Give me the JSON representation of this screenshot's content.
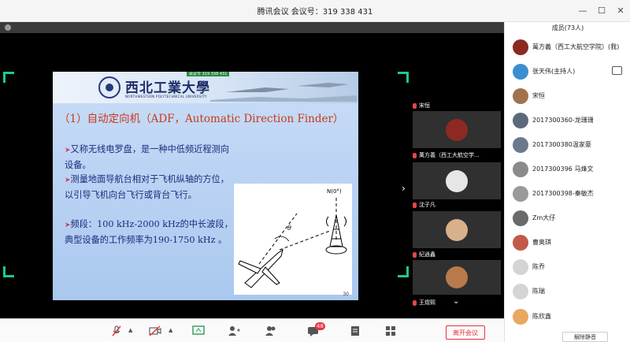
{
  "window": {
    "title": "腾讯会议  会议号：319 338 431",
    "controls": [
      "—",
      "☐",
      "✕"
    ]
  },
  "slide": {
    "university_cn": "西北工業大學",
    "university_en": "NORTHWESTERN POLYTECHNICAL UNIVERSITY",
    "meeting_tag": "会议号 319 338 431",
    "title": "（1）自动定向机（ADF，Automatic Direction Finder）",
    "bullets": [
      {
        "arrow": "➤",
        "text": "又称无线电罗盘，是一种中低频近程测向设备。"
      },
      {
        "arrow": "➤",
        "text": "测量地面导航台相对于飞机纵轴的方位，以引导飞机向台飞行或背台飞行。"
      },
      {
        "arrow": "➤",
        "text": "频段：100 kHz-2000 kHz的中长波段，典型设备的工作频率为190-1750 kHz 。"
      }
    ],
    "diagram_north": "N(0°)",
    "diagram_theta": "θ",
    "page_number": "30"
  },
  "videos": [
    {
      "name": "宋恒",
      "avatar_color": "#2a2a2a"
    },
    {
      "name": "萬方義（西工大航空学...",
      "avatar_color": "#8c2a22"
    },
    {
      "name": "沈子凡",
      "avatar_color": "#e6e6e6"
    },
    {
      "name": "纪逍鑫",
      "avatar_color": "#d9b08c"
    },
    {
      "name": "王煜熙",
      "avatar_color": "#b87a4a"
    }
  ],
  "toolbar": {
    "badge": "48",
    "leave_label": "离开会议"
  },
  "members": {
    "header": "成员(73人)",
    "items": [
      {
        "name": "萬方義（西工大航空学院）(我)",
        "avatar_color": "#8c2a22",
        "has_icon": false
      },
      {
        "name": "张天伟(主持人)",
        "avatar_color": "#3a8fd1",
        "has_icon": true
      },
      {
        "name": "宋恒",
        "avatar_color": "#a0724e",
        "has_icon": false
      },
      {
        "name": "2017300360-龙珊珊",
        "avatar_color": "#5a6a7a",
        "has_icon": false
      },
      {
        "name": "2017300380温家豪",
        "avatar_color": "#6a7a8a",
        "has_icon": false
      },
      {
        "name": "2017300396 马烽文",
        "avatar_color": "#8a8a8a",
        "has_icon": false
      },
      {
        "name": "2017300398-秦敏杰",
        "avatar_color": "#9a9a9a",
        "has_icon": false
      },
      {
        "name": "Zm大仔",
        "avatar_color": "#6a6a6a",
        "has_icon": false
      },
      {
        "name": "曹奥琪",
        "avatar_color": "#c25a4a",
        "has_icon": false
      },
      {
        "name": "陈乔",
        "avatar_color": "#d4d4d4",
        "has_icon": false
      },
      {
        "name": "陈瑞",
        "avatar_color": "#d4d4d4",
        "has_icon": false
      },
      {
        "name": "陈欣鑫",
        "avatar_color": "#e8a860",
        "has_icon": false
      }
    ],
    "mute_all": "解除静音"
  }
}
